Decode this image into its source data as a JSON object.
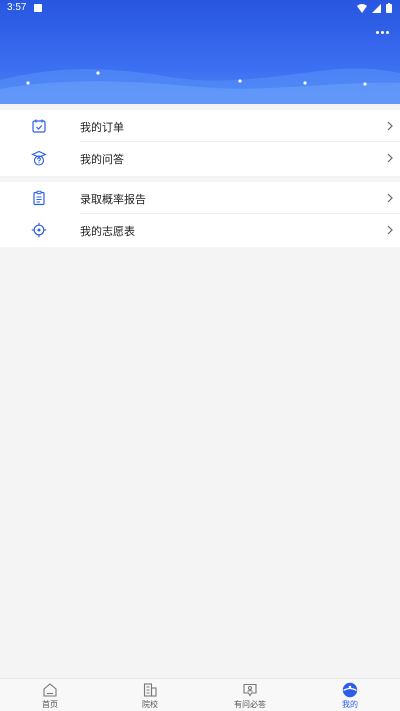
{
  "status_bar": {
    "time": "3:57"
  },
  "header": {
    "more_icon": "more-dots-icon"
  },
  "menu_groups": [
    [
      {
        "label": "我的订单",
        "icon": "calendar-check-icon"
      },
      {
        "label": "我的问答",
        "icon": "question-icon"
      }
    ],
    [
      {
        "label": "录取概率报告",
        "icon": "clipboard-icon"
      },
      {
        "label": "我的志愿表",
        "icon": "target-icon"
      }
    ]
  ],
  "tabbar": {
    "tabs": [
      {
        "label": "首页",
        "icon": "home-icon"
      },
      {
        "label": "院校",
        "icon": "building-icon"
      },
      {
        "label": "有问必答",
        "icon": "chat-icon"
      },
      {
        "label": "我的",
        "icon": "profile-icon"
      }
    ],
    "active_index": 3
  },
  "colors": {
    "accent": "#2c5ee8",
    "header_top": "#2856e0",
    "header_bottom": "#4b84f6"
  }
}
